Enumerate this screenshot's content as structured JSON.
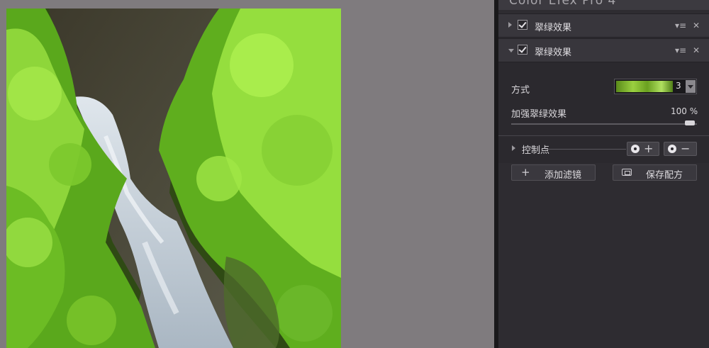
{
  "app": {
    "title": "Color Efex Pro 4"
  },
  "filters": [
    {
      "name": "翠绿效果",
      "enabled": true,
      "expanded": false
    },
    {
      "name": "翠绿效果",
      "enabled": true,
      "expanded": true
    }
  ],
  "row_icons": {
    "menu": "▾≡",
    "close": "✕"
  },
  "params": {
    "method_label": "方式",
    "method_value": "3",
    "strength_label": "加强翠绿效果",
    "strength_value": "100 %",
    "strength_fraction": 1.0
  },
  "control_points": {
    "label": "控制点",
    "add_sign": "+",
    "remove_sign": "−"
  },
  "actions": {
    "add_filter": "添加滤镜",
    "save_recipe": "保存配方"
  },
  "icons": [
    "expand-arrow-icon",
    "checkbox-icon",
    "menu-icon",
    "close-icon",
    "add-control-point-icon",
    "remove-control-point-icon",
    "plus-icon",
    "recipe-icon"
  ],
  "colors": {
    "panel_bg": "#2e2c31",
    "canvas_bg": "#7f7b7e",
    "accent_green": "#8ccf2c"
  }
}
